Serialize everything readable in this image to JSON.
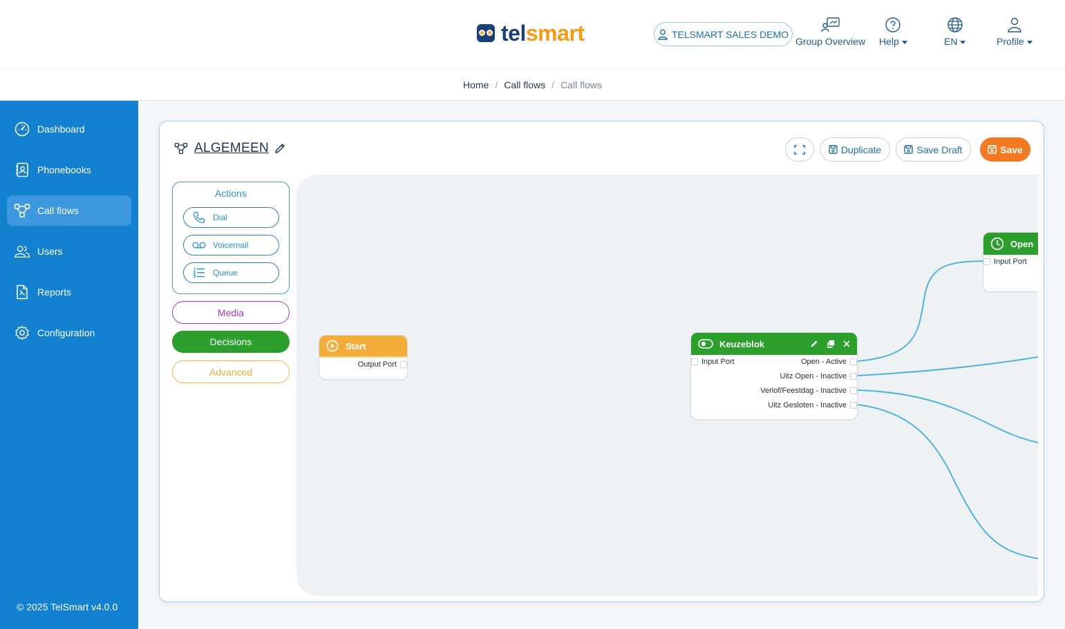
{
  "brand": {
    "text_a": "tel",
    "text_b": "smart"
  },
  "header": {
    "account": "TELSMART SALES DEMO",
    "group_overview": "Group Overview",
    "help": "Help",
    "language": "EN",
    "profile": "Profile"
  },
  "breadcrumb": [
    "Home",
    "Call flows",
    "Call flows"
  ],
  "sidebar": {
    "items": [
      {
        "label": "Dashboard",
        "icon": "dashboard-gauge-icon"
      },
      {
        "label": "Phonebooks",
        "icon": "phonebook-icon"
      },
      {
        "label": "Call flows",
        "icon": "callflow-icon",
        "active": true
      },
      {
        "label": "Users",
        "icon": "users-icon"
      },
      {
        "label": "Reports",
        "icon": "report-icon"
      },
      {
        "label": "Configuration",
        "icon": "gear-icon"
      }
    ],
    "footer": "© 2025 TelSmart  v4.0.0"
  },
  "flow": {
    "title": "ALGEMEEN",
    "buttons": {
      "duplicate": "Duplicate",
      "save_draft": "Save Draft",
      "save": "Save"
    }
  },
  "palette": {
    "actions_heading": "Actions",
    "actions": [
      "Dial",
      "Voicemail",
      "Queue"
    ],
    "categories": {
      "media": "Media",
      "decisions": "Decisions",
      "advanced": "Advanced"
    }
  },
  "nodes": {
    "start": {
      "title": "Start",
      "output": "Output Port"
    },
    "keuzeblok": {
      "title": "Keuzeblok",
      "input": "Input Port",
      "outputs": [
        "Open - Active",
        "Uitz Open - Inactive",
        "Verlof/Feestdag - Inactive",
        "Uitz Gesloten - Inactive"
      ]
    },
    "open": {
      "title": "Open",
      "input": "Input Port"
    }
  },
  "colors": {
    "sidebar": "#1380d0",
    "accent": "#1e6fa8",
    "save": "#f37a24",
    "decision": "#2c9e2c",
    "start": "#f4ad3b",
    "wire": "#4fb3dc"
  }
}
